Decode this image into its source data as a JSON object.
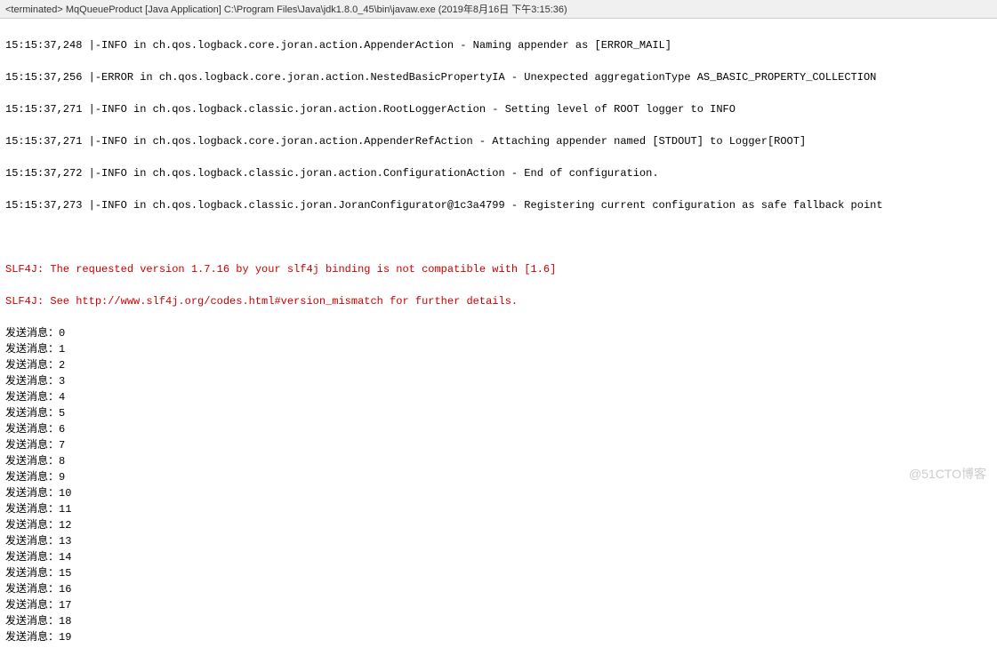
{
  "header": {
    "status": "<terminated>",
    "app_name": "MqQueueProduct",
    "app_type": "[Java Application]",
    "exe_path": "C:\\Program Files\\Java\\jdk1.8.0_45\\bin\\javaw.exe",
    "timestamp": "(2019年8月16日 下午3:15:36)"
  },
  "logs": [
    "15:15:37,248 |-INFO in ch.qos.logback.core.joran.action.AppenderAction - Naming appender as [ERROR_MAIL]",
    "15:15:37,256 |-ERROR in ch.qos.logback.core.joran.action.NestedBasicPropertyIA - Unexpected aggregationType AS_BASIC_PROPERTY_COLLECTION",
    "15:15:37,271 |-INFO in ch.qos.logback.classic.joran.action.RootLoggerAction - Setting level of ROOT logger to INFO",
    "15:15:37,271 |-INFO in ch.qos.logback.core.joran.action.AppenderRefAction - Attaching appender named [STDOUT] to Logger[ROOT]",
    "15:15:37,272 |-INFO in ch.qos.logback.classic.joran.action.ConfigurationAction - End of configuration.",
    "15:15:37,273 |-INFO in ch.qos.logback.classic.joran.JoranConfigurator@1c3a4799 - Registering current configuration as safe fallback point"
  ],
  "errors": [
    "SLF4J: The requested version 1.7.16 by your slf4j binding is not compatible with [1.6]",
    "SLF4J: See http://www.slf4j.org/codes.html#version_mismatch for further details."
  ],
  "message_prefix": "发送消息：",
  "messages": [
    0,
    1,
    2,
    3,
    4,
    5,
    6,
    7,
    8,
    9,
    10,
    11,
    12,
    13,
    14,
    15,
    16,
    17,
    18,
    19
  ],
  "watermark": "@51CTO博客"
}
